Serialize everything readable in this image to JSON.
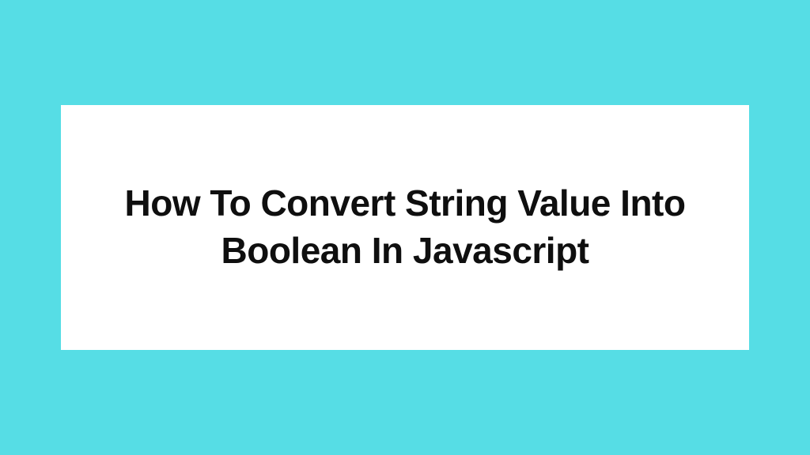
{
  "card": {
    "title": "How To Convert String Value Into Boolean In Javascript"
  },
  "colors": {
    "background": "#56dde5",
    "card_background": "#ffffff",
    "text": "#0f0f0f"
  }
}
